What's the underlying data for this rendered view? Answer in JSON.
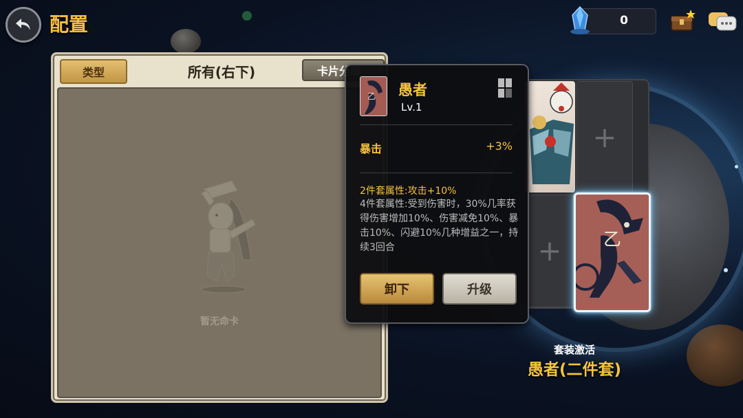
{
  "header": {
    "title": "配置"
  },
  "currency": {
    "value": "0"
  },
  "left_panel": {
    "type_button": "类型",
    "filter_title": "所有(右下)",
    "category_button": "卡片分级",
    "empty_text": "暂无命卡"
  },
  "slots": {
    "plus_symbol": "+"
  },
  "set_activation": {
    "label": "套装激活",
    "name": "愚者(二件套)"
  },
  "tooltip": {
    "card_name": "愚者",
    "level": "Lv.1",
    "stat_name": "暴击",
    "stat_value": "+3%",
    "set_2": "2件套属性:攻击+10%",
    "set_4": "4件套属性:受到伤害时，30%几率获得伤害增加10%、伤害减免10%、暴击10%、闪避10%几种增益之一，持续3回合",
    "unequip_button": "卸下",
    "upgrade_button": "升级"
  },
  "colors": {
    "accent_gold": "#f6c33e",
    "panel_bg": "#e8e1cc",
    "card_red": "#a56058",
    "highlight_glow": "#6fc8ff"
  },
  "icons": {
    "back": "back-arrow-icon",
    "currency": "crystal-icon",
    "chest": "treasure-chest-icon",
    "chat": "chat-bubble-icon",
    "slot_grid": "slot-grid-icon"
  }
}
